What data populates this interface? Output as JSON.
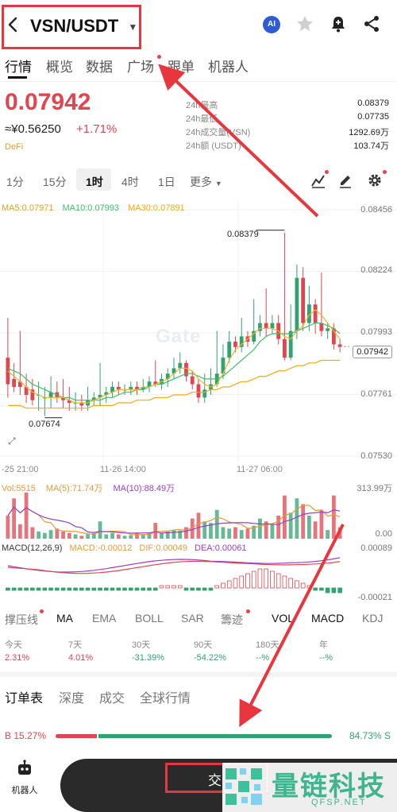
{
  "header": {
    "pair": "VSN/USDT",
    "ai_badge": "AI"
  },
  "tabs": [
    "行情",
    "概览",
    "数据",
    "广场",
    "跟单",
    "机器人"
  ],
  "price": {
    "last": "0.07942",
    "cny": "≈¥0.56250",
    "change": "+1.71%",
    "category": "DeFi"
  },
  "stats": [
    {
      "label": "24h最高",
      "value": "0.08379"
    },
    {
      "label": "24h最低",
      "value": "0.07735"
    },
    {
      "label": "24h成交量(VSN)",
      "value": "1292.69万"
    },
    {
      "label": "24h额 (USDT)",
      "value": "103.74万"
    }
  ],
  "timeframes": [
    "1分",
    "15分",
    "1时",
    "4时",
    "1日",
    "更多"
  ],
  "ma_legend": {
    "ma5": "MA5:0.07971",
    "ma10": "MA10:0.07993",
    "ma30": "MA30:0.07891"
  },
  "axis": {
    "price": [
      "0.08456",
      "0.08224",
      "0.07993",
      "0.07761",
      "0.07530"
    ],
    "time": [
      "-25 21:00",
      "11-26 14:00",
      "11-27 06:00"
    ],
    "vol": [
      "313.99万",
      "0.00"
    ],
    "macd": [
      "0.00089",
      "-0.00021"
    ]
  },
  "annotations": {
    "high": "0.08379",
    "low": "0.07674",
    "current": "0.07942"
  },
  "watermark": "Gate",
  "volume_legend": {
    "vol": "Vol:5515",
    "ma5": "MA(5):71.74万",
    "ma10": "MA(10):88.49万"
  },
  "macd_legend": {
    "name": "MACD(12,26,9)",
    "macd": "MACD:-0.00012",
    "dif": "DIF:0.00049",
    "dea": "DEA:0.00061"
  },
  "indicators": [
    "撑压线",
    "MA",
    "EMA",
    "BOLL",
    "SAR",
    "籌迹",
    "VOL",
    "MACD",
    "KDJ"
  ],
  "periods": [
    {
      "label": "今天",
      "value": "2.31%"
    },
    {
      "label": "7天",
      "value": "4.01%"
    },
    {
      "label": "30天",
      "value": "-31.39%"
    },
    {
      "label": "90天",
      "value": "-54.22%"
    },
    {
      "label": "180天",
      "value": "--%"
    },
    {
      "label": "年",
      "value": "--%"
    }
  ],
  "orderbook_tabs": [
    "订单表",
    "深度",
    "成交",
    "全球行情"
  ],
  "ratio": {
    "buy": "B 15.27%",
    "sell": "84.73% S",
    "buy_fraction": 0.1527
  },
  "bottom": {
    "robot_label": "机器人",
    "trade_label": "交"
  },
  "logo_text": {
    "cn": "量链科技",
    "en": "QFSP.NET"
  },
  "colors": {
    "up": "#33a271",
    "down": "#e0464f",
    "ma5": "#f0b429",
    "ma10": "#3fbf6a",
    "ma30": "#f2a90f",
    "annot": "#e8363f"
  },
  "chart_data": {
    "type": "candlestick",
    "ylim": [
      0.0753,
      0.08456
    ],
    "candles": [
      [
        0.079,
        0.078,
        0.0805,
        0.0775
      ],
      [
        0.0782,
        0.0779,
        0.0788,
        0.0777
      ],
      [
        0.0781,
        0.0779,
        0.08,
        0.0776
      ],
      [
        0.0779,
        0.0776,
        0.0784,
        0.0773
      ],
      [
        0.0778,
        0.0774,
        0.0782,
        0.0772
      ],
      [
        0.0776,
        0.0776,
        0.0781,
        0.077
      ],
      [
        0.0775,
        0.0775,
        0.0779,
        0.0768
      ],
      [
        0.0775,
        0.0777,
        0.0783,
        0.0771
      ],
      [
        0.0777,
        0.0775,
        0.0781,
        0.0773
      ],
      [
        0.0775,
        0.0774,
        0.0782,
        0.0771
      ],
      [
        0.0774,
        0.0773,
        0.0779,
        0.077
      ],
      [
        0.0773,
        0.0773,
        0.0777,
        0.077
      ],
      [
        0.0773,
        0.0772,
        0.0776,
        0.077
      ],
      [
        0.0772,
        0.0774,
        0.0779,
        0.077
      ],
      [
        0.0774,
        0.0775,
        0.0777,
        0.0772
      ],
      [
        0.0775,
        0.0776,
        0.0788,
        0.0772
      ],
      [
        0.0776,
        0.0777,
        0.0779,
        0.0773
      ],
      [
        0.0777,
        0.0779,
        0.0781,
        0.0775
      ],
      [
        0.0779,
        0.0778,
        0.0781,
        0.0776
      ],
      [
        0.0778,
        0.0778,
        0.078,
        0.0776
      ],
      [
        0.0778,
        0.0779,
        0.0781,
        0.0776
      ],
      [
        0.0779,
        0.0778,
        0.0781,
        0.0776
      ],
      [
        0.0778,
        0.0779,
        0.0782,
        0.0777
      ],
      [
        0.0779,
        0.0781,
        0.0783,
        0.0777
      ],
      [
        0.0781,
        0.078,
        0.0789,
        0.0779
      ],
      [
        0.078,
        0.0782,
        0.0784,
        0.0778
      ],
      [
        0.0782,
        0.0784,
        0.0786,
        0.0779
      ],
      [
        0.0784,
        0.0786,
        0.079,
        0.0782
      ],
      [
        0.0786,
        0.0788,
        0.0792,
        0.0784
      ],
      [
        0.0788,
        0.0783,
        0.0789,
        0.0781
      ],
      [
        0.0783,
        0.078,
        0.0785,
        0.0778
      ],
      [
        0.078,
        0.0775,
        0.0782,
        0.0773
      ],
      [
        0.0775,
        0.0778,
        0.0784,
        0.0773
      ],
      [
        0.0778,
        0.078,
        0.0786,
        0.0776
      ],
      [
        0.078,
        0.0784,
        0.08,
        0.0779
      ],
      [
        0.0784,
        0.079,
        0.0795,
        0.0782
      ],
      [
        0.079,
        0.0796,
        0.08,
        0.0788
      ],
      [
        0.0796,
        0.0794,
        0.0798,
        0.0792
      ],
      [
        0.0794,
        0.0798,
        0.0805,
        0.0792
      ],
      [
        0.0798,
        0.0796,
        0.08,
        0.0794
      ],
      [
        0.0796,
        0.08,
        0.0812,
        0.0795
      ],
      [
        0.08,
        0.0803,
        0.0806,
        0.0798
      ],
      [
        0.0803,
        0.0801,
        0.0816,
        0.0798
      ],
      [
        0.0801,
        0.0803,
        0.0806,
        0.0799
      ],
      [
        0.0803,
        0.0797,
        0.0806,
        0.0795
      ],
      [
        0.0797,
        0.079,
        0.0837,
        0.0789
      ],
      [
        0.079,
        0.08,
        0.081,
        0.0789
      ],
      [
        0.08,
        0.082,
        0.0825,
        0.0797
      ],
      [
        0.082,
        0.0803,
        0.0824,
        0.08
      ],
      [
        0.0803,
        0.081,
        0.0817,
        0.08
      ],
      [
        0.081,
        0.0803,
        0.0812,
        0.0799
      ],
      [
        0.0803,
        0.08,
        0.0822,
        0.0798
      ],
      [
        0.08,
        0.0801,
        0.0803,
        0.0797
      ],
      [
        0.0801,
        0.0795,
        0.0803,
        0.0793
      ],
      [
        0.0795,
        0.0794,
        0.0797,
        0.0792
      ]
    ],
    "ma5": [
      0.0785,
      0.0783,
      0.0781,
      0.0779,
      0.0777,
      0.0776,
      0.0775,
      0.0775,
      0.0775,
      0.0775,
      0.0774,
      0.0773,
      0.0773,
      0.0773,
      0.0774,
      0.0775,
      0.0776,
      0.0777,
      0.0778,
      0.0778,
      0.0778,
      0.0778,
      0.0779,
      0.0779,
      0.078,
      0.0781,
      0.0782,
      0.0784,
      0.0786,
      0.0786,
      0.0785,
      0.0782,
      0.078,
      0.0779,
      0.078,
      0.0784,
      0.0789,
      0.0793,
      0.0795,
      0.0797,
      0.0799,
      0.0801,
      0.0801,
      0.0801,
      0.08,
      0.0798,
      0.0797,
      0.08,
      0.0802,
      0.0806,
      0.0808,
      0.0806,
      0.0803,
      0.08,
      0.0797
    ],
    "ma10": [
      0.0786,
      0.0785,
      0.0784,
      0.0782,
      0.078,
      0.0779,
      0.0778,
      0.0777,
      0.0776,
      0.0775,
      0.0775,
      0.0774,
      0.0774,
      0.0774,
      0.0774,
      0.0774,
      0.0775,
      0.0775,
      0.0776,
      0.0777,
      0.0777,
      0.0778,
      0.0778,
      0.0779,
      0.078,
      0.078,
      0.0781,
      0.0782,
      0.0783,
      0.0784,
      0.0784,
      0.0783,
      0.0782,
      0.0782,
      0.0782,
      0.0783,
      0.0785,
      0.0787,
      0.0789,
      0.0791,
      0.0793,
      0.0796,
      0.0798,
      0.0799,
      0.0799,
      0.0799,
      0.0799,
      0.08,
      0.0801,
      0.0802,
      0.0803,
      0.0803,
      0.0802,
      0.0801,
      0.0799
    ],
    "ma30": [
      0.0772,
      0.0772,
      0.0772,
      0.0771,
      0.0771,
      0.0771,
      0.0771,
      0.0771,
      0.0771,
      0.0771,
      0.0771,
      0.0771,
      0.0771,
      0.0771,
      0.0772,
      0.0772,
      0.0772,
      0.0772,
      0.0773,
      0.0773,
      0.0773,
      0.0774,
      0.0774,
      0.0774,
      0.0775,
      0.0775,
      0.0775,
      0.0776,
      0.0776,
      0.0776,
      0.0777,
      0.0777,
      0.0777,
      0.0778,
      0.0778,
      0.0779,
      0.0779,
      0.078,
      0.0781,
      0.0781,
      0.0782,
      0.0783,
      0.0783,
      0.0784,
      0.0785,
      0.0785,
      0.0786,
      0.0787,
      0.0787,
      0.0788,
      0.0788,
      0.0789,
      0.0789,
      0.0789,
      0.0789
    ],
    "volume": [
      80,
      140,
      50,
      160,
      40,
      25,
      20,
      30,
      35,
      25,
      20,
      15,
      10,
      15,
      20,
      60,
      15,
      20,
      15,
      10,
      12,
      18,
      15,
      20,
      55,
      20,
      25,
      30,
      28,
      40,
      70,
      90,
      60,
      55,
      100,
      40,
      35,
      40,
      30,
      35,
      45,
      70,
      60,
      50,
      80,
      150,
      90,
      140,
      120,
      80,
      60,
      100,
      30,
      150,
      40
    ],
    "macd_hist": [
      -1,
      -1,
      -1,
      -1,
      -1,
      -1,
      -1,
      -1,
      -1,
      -1,
      -1,
      -1,
      -1,
      -1,
      -1,
      -1,
      -1,
      -1,
      -1,
      -1,
      -1,
      -1,
      -1,
      -1,
      -1,
      1,
      1,
      1,
      1,
      -1,
      -1,
      -1,
      -1,
      -1,
      1,
      2,
      3,
      4,
      5,
      6,
      7,
      8,
      8,
      7,
      6,
      5,
      4,
      3,
      2,
      1,
      -1,
      -1,
      -2,
      -2,
      -2
    ]
  }
}
